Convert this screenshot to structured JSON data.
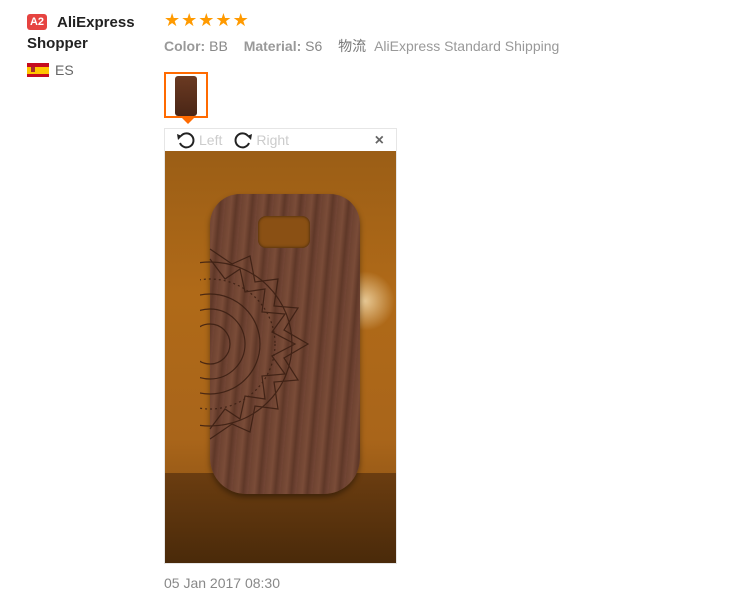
{
  "user": {
    "badge": "A2",
    "name_line1": "AliExpress",
    "name_line2": "Shopper",
    "country_code": "ES",
    "flag_icon": "spain-flag-icon"
  },
  "review": {
    "stars": 5,
    "star_glyph": "★",
    "color_label": "Color:",
    "color_value": "BB",
    "material_label": "Material:",
    "material_value": "S6",
    "shipping_label": "物流",
    "shipping_value": "AliExpress Standard Shipping",
    "date": "05 Jan 2017 08:30"
  },
  "viewer": {
    "rotate_left_label": "Left",
    "rotate_right_label": "Right",
    "close_label": "×"
  },
  "colors": {
    "accent": "#ff6a00",
    "star": "#ff9a00",
    "badge": "#e64340"
  }
}
